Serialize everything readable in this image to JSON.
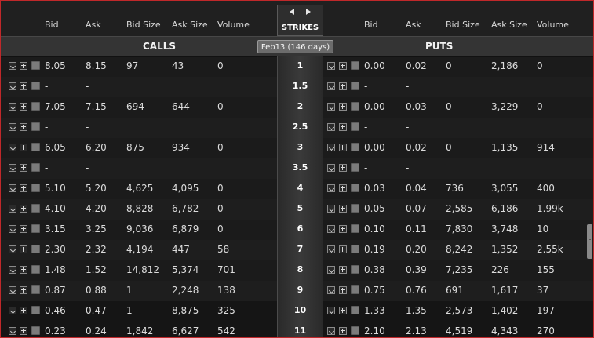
{
  "headers": {
    "calls": {
      "bid": "Bid",
      "ask": "Ask",
      "bid_size": "Bid Size",
      "ask_size": "Ask Size",
      "volume": "Volume"
    },
    "puts": {
      "bid": "Bid",
      "ask": "Ask",
      "bid_size": "Bid Size",
      "ask_size": "Ask Size",
      "volume": "Volume"
    }
  },
  "section_titles": {
    "calls": "CALLS",
    "puts": "PUTS"
  },
  "strikes_label": "STRIKES",
  "expiration": "Feb13  (146 days)",
  "icons": [
    "pin-icon",
    "expand-plus-icon",
    "row-select-box-icon",
    "prev-arrow-icon",
    "next-arrow-icon"
  ],
  "rows": [
    {
      "strike": "1",
      "call": {
        "bid": "8.05",
        "ask": "8.15",
        "bid_size": "97",
        "ask_size": "43",
        "volume": "0"
      },
      "put": {
        "bid": "0.00",
        "ask": "0.02",
        "bid_size": "0",
        "ask_size": "2,186",
        "volume": "0"
      }
    },
    {
      "strike": "1.5",
      "call": {
        "bid": "-",
        "ask": "-",
        "bid_size": "",
        "ask_size": "",
        "volume": ""
      },
      "put": {
        "bid": "-",
        "ask": "-",
        "bid_size": "",
        "ask_size": "",
        "volume": ""
      }
    },
    {
      "strike": "2",
      "call": {
        "bid": "7.05",
        "ask": "7.15",
        "bid_size": "694",
        "ask_size": "644",
        "volume": "0"
      },
      "put": {
        "bid": "0.00",
        "ask": "0.03",
        "bid_size": "0",
        "ask_size": "3,229",
        "volume": "0"
      }
    },
    {
      "strike": "2.5",
      "call": {
        "bid": "-",
        "ask": "-",
        "bid_size": "",
        "ask_size": "",
        "volume": ""
      },
      "put": {
        "bid": "-",
        "ask": "-",
        "bid_size": "",
        "ask_size": "",
        "volume": ""
      }
    },
    {
      "strike": "3",
      "call": {
        "bid": "6.05",
        "ask": "6.20",
        "bid_size": "875",
        "ask_size": "934",
        "volume": "0"
      },
      "put": {
        "bid": "0.00",
        "ask": "0.02",
        "bid_size": "0",
        "ask_size": "1,135",
        "volume": "914"
      }
    },
    {
      "strike": "3.5",
      "call": {
        "bid": "-",
        "ask": "-",
        "bid_size": "",
        "ask_size": "",
        "volume": ""
      },
      "put": {
        "bid": "-",
        "ask": "-",
        "bid_size": "",
        "ask_size": "",
        "volume": ""
      }
    },
    {
      "strike": "4",
      "call": {
        "bid": "5.10",
        "ask": "5.20",
        "bid_size": "4,625",
        "ask_size": "4,095",
        "volume": "0"
      },
      "put": {
        "bid": "0.03",
        "ask": "0.04",
        "bid_size": "736",
        "ask_size": "3,055",
        "volume": "400"
      }
    },
    {
      "strike": "5",
      "call": {
        "bid": "4.10",
        "ask": "4.20",
        "bid_size": "8,828",
        "ask_size": "6,782",
        "volume": "0"
      },
      "put": {
        "bid": "0.05",
        "ask": "0.07",
        "bid_size": "2,585",
        "ask_size": "6,186",
        "volume": "1.99k"
      }
    },
    {
      "strike": "6",
      "call": {
        "bid": "3.15",
        "ask": "3.25",
        "bid_size": "9,036",
        "ask_size": "6,879",
        "volume": "0"
      },
      "put": {
        "bid": "0.10",
        "ask": "0.11",
        "bid_size": "7,830",
        "ask_size": "3,748",
        "volume": "10"
      }
    },
    {
      "strike": "7",
      "call": {
        "bid": "2.30",
        "ask": "2.32",
        "bid_size": "4,194",
        "ask_size": "447",
        "volume": "58"
      },
      "put": {
        "bid": "0.19",
        "ask": "0.20",
        "bid_size": "8,242",
        "ask_size": "1,352",
        "volume": "2.55k"
      }
    },
    {
      "strike": "8",
      "call": {
        "bid": "1.48",
        "ask": "1.52",
        "bid_size": "14,812",
        "ask_size": "5,374",
        "volume": "701"
      },
      "put": {
        "bid": "0.38",
        "ask": "0.39",
        "bid_size": "7,235",
        "ask_size": "226",
        "volume": "155"
      }
    },
    {
      "strike": "9",
      "call": {
        "bid": "0.87",
        "ask": "0.88",
        "bid_size": "1",
        "ask_size": "2,248",
        "volume": "138"
      },
      "put": {
        "bid": "0.75",
        "ask": "0.76",
        "bid_size": "691",
        "ask_size": "1,617",
        "volume": "37"
      }
    },
    {
      "strike": "10",
      "call": {
        "bid": "0.46",
        "ask": "0.47",
        "bid_size": "1",
        "ask_size": "8,875",
        "volume": "325"
      },
      "put": {
        "bid": "1.33",
        "ask": "1.35",
        "bid_size": "2,573",
        "ask_size": "1,402",
        "volume": "197"
      }
    },
    {
      "strike": "11",
      "call": {
        "bid": "0.23",
        "ask": "0.24",
        "bid_size": "1,842",
        "ask_size": "6,627",
        "volume": "542"
      },
      "put": {
        "bid": "2.10",
        "ask": "2.13",
        "bid_size": "4,519",
        "ask_size": "4,343",
        "volume": "270"
      }
    }
  ]
}
